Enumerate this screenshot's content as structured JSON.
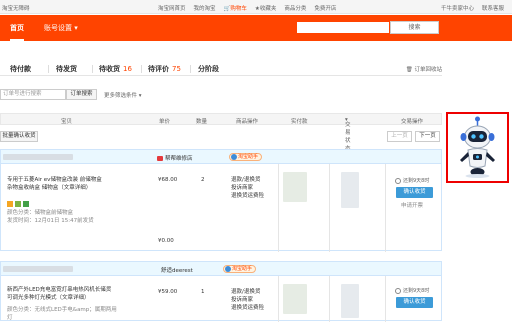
{
  "topbar": {
    "left": "淘宝无障碍",
    "links": [
      "淘宝网首页",
      "我的淘宝",
      "购物车",
      "收藏夹",
      "商品分类",
      "免费开店"
    ],
    "cart_count": "0",
    "right": [
      "千牛卖家中心",
      "联系客服"
    ]
  },
  "header": {
    "tabs": [
      "首页",
      "账号设置"
    ],
    "search_button": "搜索"
  },
  "status_tabs": [
    {
      "label": "待付款",
      "count": ""
    },
    {
      "label": "待发货",
      "count": ""
    },
    {
      "label": "待收货",
      "count": "16"
    },
    {
      "label": "待评价",
      "count": "75"
    },
    {
      "label": "分阶段",
      "count": ""
    }
  ],
  "recycle_label": "订单回收站",
  "filter": {
    "placeholder": "订单号进行搜索",
    "search_button": "订单搜索",
    "more": "更多筛选条件"
  },
  "table_headers": [
    "宝贝",
    "单价",
    "数量",
    "商品操作",
    "实付款",
    "交易状态",
    "交易操作"
  ],
  "batch_button": "批量确认收货",
  "pager": {
    "prev": "上一页",
    "next": "下一页"
  },
  "orders": [
    {
      "shop": "帮帮维修店",
      "seal": "淘宝助手",
      "title": "专用于五菱Air ev储物盒改装 前储物盒杂物盒收纳盒 储物盒（文章详细）",
      "note": "颜色分类：储物盒前储物盒",
      "ship": "发货时间：12月01日 15:47前发货",
      "price": "¥68.00",
      "qty": "2",
      "actions": [
        "退款/退换货",
        "投诉商家",
        "退换货运费险"
      ],
      "total_price": "¥0.00",
      "deadline": "还剩9天8时",
      "confirm": "确认收货",
      "extend": "申请开票"
    },
    {
      "shop": "舒适deerest",
      "seal": "淘宝助手",
      "title": "新西产外LED充电富霓灯串电热风机长储货可调光多种灯光模式（文章详细）",
      "note": "颜色分类：无线式LED手电&amp；属期两用灯",
      "ship": "",
      "price": "¥59.00",
      "qty": "1",
      "actions": [
        "退款/退换货",
        "投诉商家",
        "退换货运费险"
      ],
      "total_price": "",
      "deadline": "还剩9天8时",
      "confirm": "确认收货",
      "extend": ""
    }
  ]
}
